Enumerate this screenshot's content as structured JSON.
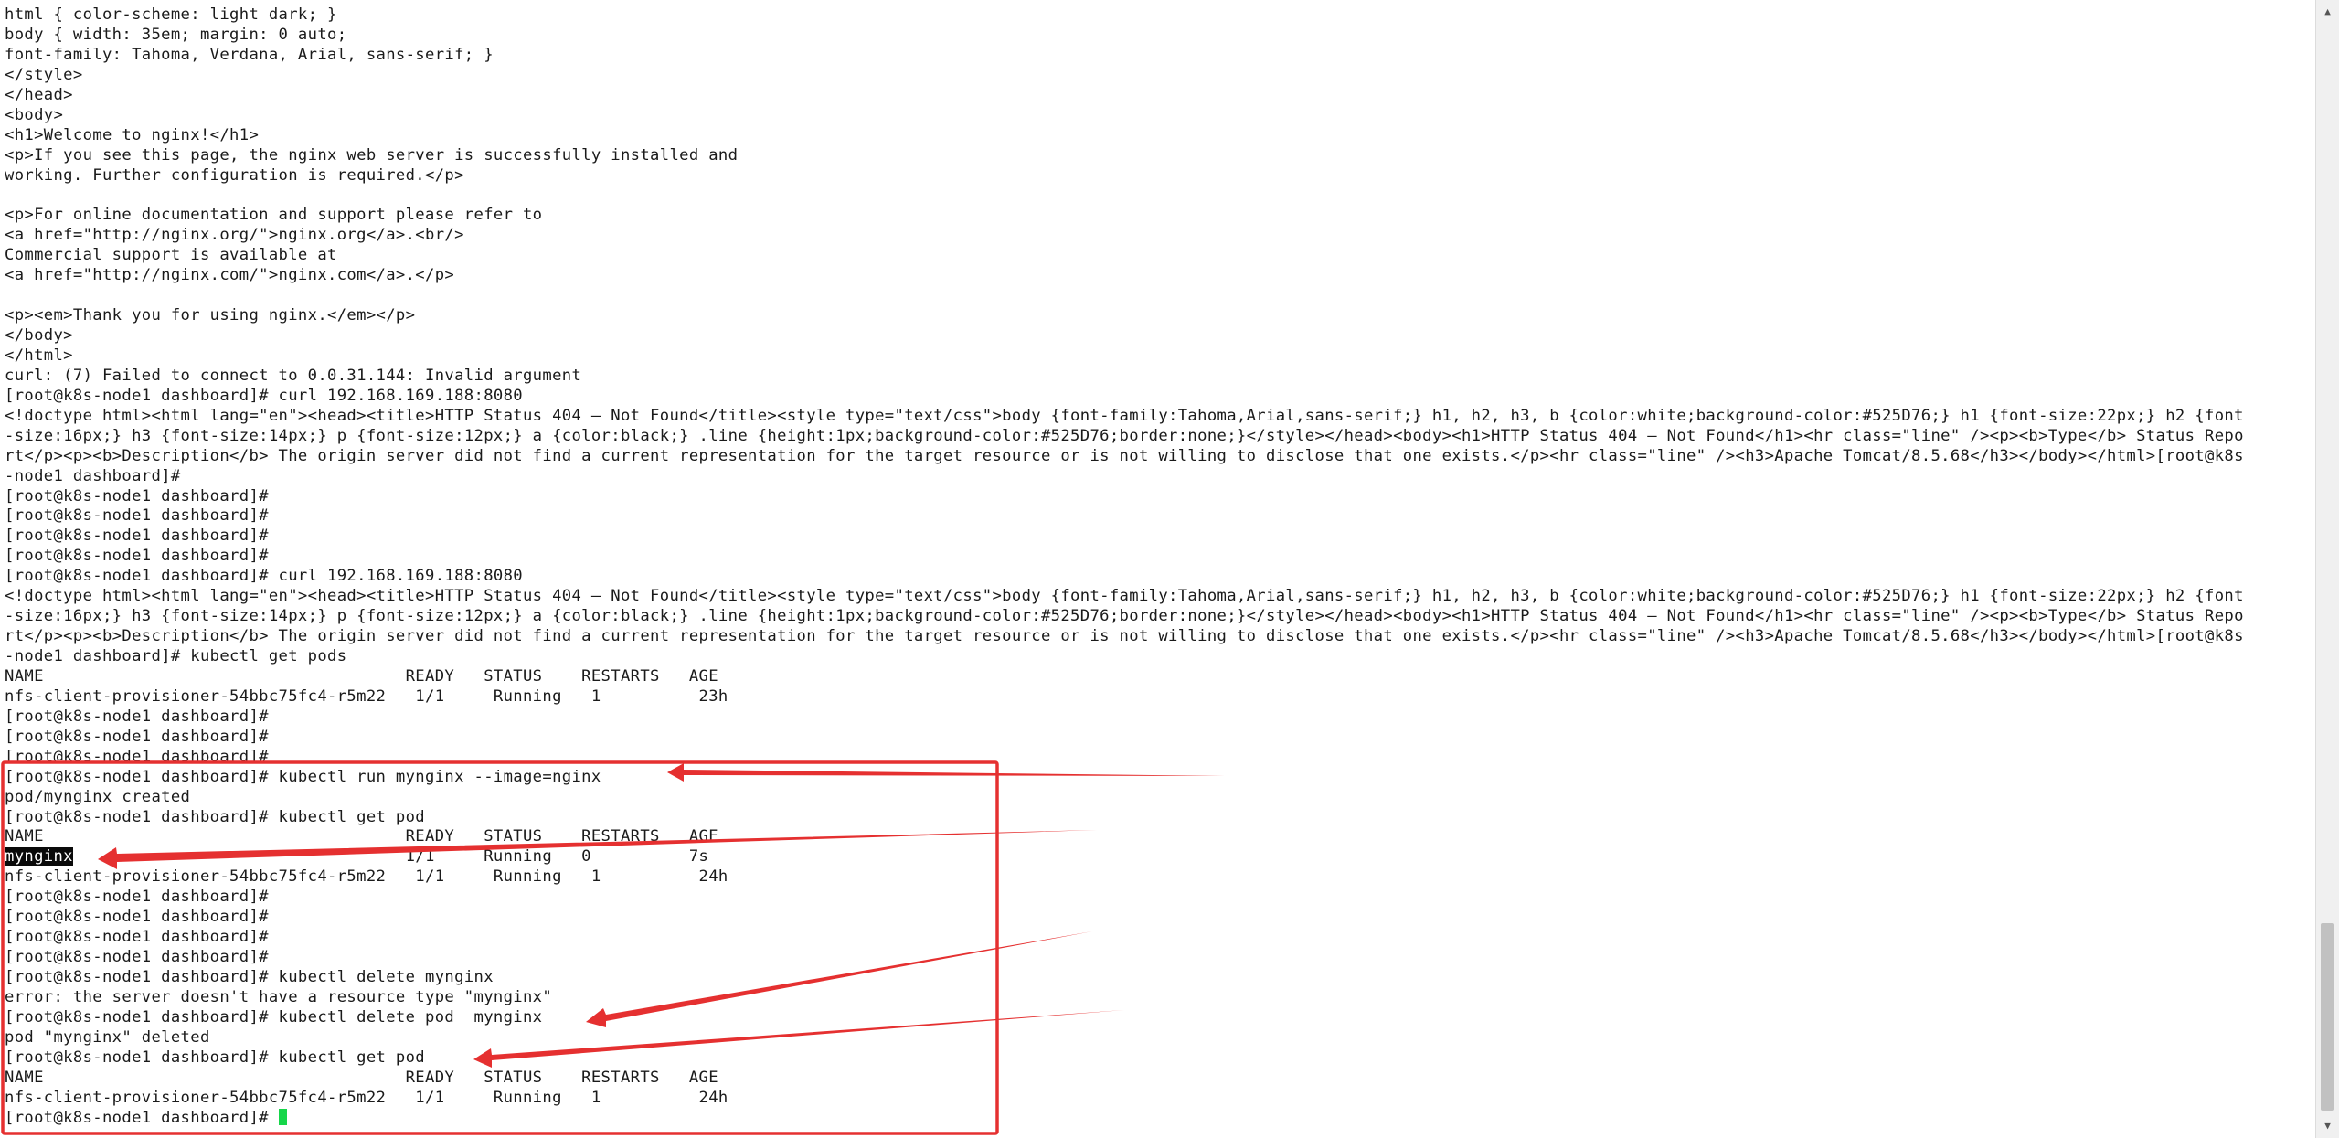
{
  "terminal": {
    "lines": [
      "html { color-scheme: light dark; }",
      "body { width: 35em; margin: 0 auto;",
      "font-family: Tahoma, Verdana, Arial, sans-serif; }",
      "</style>",
      "</head>",
      "<body>",
      "<h1>Welcome to nginx!</h1>",
      "<p>If you see this page, the nginx web server is successfully installed and",
      "working. Further configuration is required.</p>",
      "",
      "<p>For online documentation and support please refer to",
      "<a href=\"http://nginx.org/\">nginx.org</a>.<br/>",
      "Commercial support is available at",
      "<a href=\"http://nginx.com/\">nginx.com</a>.</p>",
      "",
      "<p><em>Thank you for using nginx.</em></p>",
      "</body>",
      "</html>",
      "curl: (7) Failed to connect to 0.0.31.144: Invalid argument",
      "[root@k8s-node1 dashboard]# curl 192.168.169.188:8080",
      "<!doctype html><html lang=\"en\"><head><title>HTTP Status 404 – Not Found</title><style type=\"text/css\">body {font-family:Tahoma,Arial,sans-serif;} h1, h2, h3, b {color:white;background-color:#525D76;} h1 {font-size:22px;} h2 {font",
      "-size:16px;} h3 {font-size:14px;} p {font-size:12px;} a {color:black;} .line {height:1px;background-color:#525D76;border:none;}</style></head><body><h1>HTTP Status 404 – Not Found</h1><hr class=\"line\" /><p><b>Type</b> Status Repo",
      "rt</p><p><b>Description</b> The origin server did not find a current representation for the target resource or is not willing to disclose that one exists.</p><hr class=\"line\" /><h3>Apache Tomcat/8.5.68</h3></body></html>[root@k8s",
      "-node1 dashboard]#",
      "[root@k8s-node1 dashboard]#",
      "[root@k8s-node1 dashboard]#",
      "[root@k8s-node1 dashboard]#",
      "[root@k8s-node1 dashboard]#",
      "[root@k8s-node1 dashboard]# curl 192.168.169.188:8080",
      "<!doctype html><html lang=\"en\"><head><title>HTTP Status 404 – Not Found</title><style type=\"text/css\">body {font-family:Tahoma,Arial,sans-serif;} h1, h2, h3, b {color:white;background-color:#525D76;} h1 {font-size:22px;} h2 {font",
      "-size:16px;} h3 {font-size:14px;} p {font-size:12px;} a {color:black;} .line {height:1px;background-color:#525D76;border:none;}</style></head><body><h1>HTTP Status 404 – Not Found</h1><hr class=\"line\" /><p><b>Type</b> Status Repo",
      "rt</p><p><b>Description</b> The origin server did not find a current representation for the target resource or is not willing to disclose that one exists.</p><hr class=\"line\" /><h3>Apache Tomcat/8.5.68</h3></body></html>[root@k8s",
      "-node1 dashboard]# kubectl get pods",
      "NAME                                     READY   STATUS    RESTARTS   AGE",
      "nfs-client-provisioner-54bbc75fc4-r5m22   1/1     Running   1          23h",
      "[root@k8s-node1 dashboard]#",
      "[root@k8s-node1 dashboard]#",
      "[root@k8s-node1 dashboard]#",
      "[root@k8s-node1 dashboard]# kubectl run mynginx --image=nginx",
      "pod/mynginx created",
      "[root@k8s-node1 dashboard]# kubectl get pod",
      "NAME                                     READY   STATUS    RESTARTS   AGE",
      "",
      "nfs-client-provisioner-54bbc75fc4-r5m22   1/1     Running   1          24h",
      "[root@k8s-node1 dashboard]#",
      "[root@k8s-node1 dashboard]#",
      "[root@k8s-node1 dashboard]#",
      "[root@k8s-node1 dashboard]#",
      "[root@k8s-node1 dashboard]# kubectl delete mynginx",
      "error: the server doesn't have a resource type \"mynginx\"",
      "[root@k8s-node1 dashboard]# kubectl delete pod  mynginx",
      "pod \"mynginx\" deleted",
      "[root@k8s-node1 dashboard]# kubectl get pod",
      "NAME                                     READY   STATUS    RESTARTS   AGE",
      "nfs-client-provisioner-54bbc75fc4-r5m22   1/1     Running   1          24h"
    ],
    "selected_row": {
      "selected_text": "mynginx",
      "rest": "                                  1/1     Running   0          7s"
    },
    "prompt_line": "[root@k8s-node1 dashboard]# "
  },
  "annotation_color": "#e53030",
  "icons": {
    "scroll_up": "arrow-up-icon",
    "scroll_down": "arrow-down-icon"
  }
}
